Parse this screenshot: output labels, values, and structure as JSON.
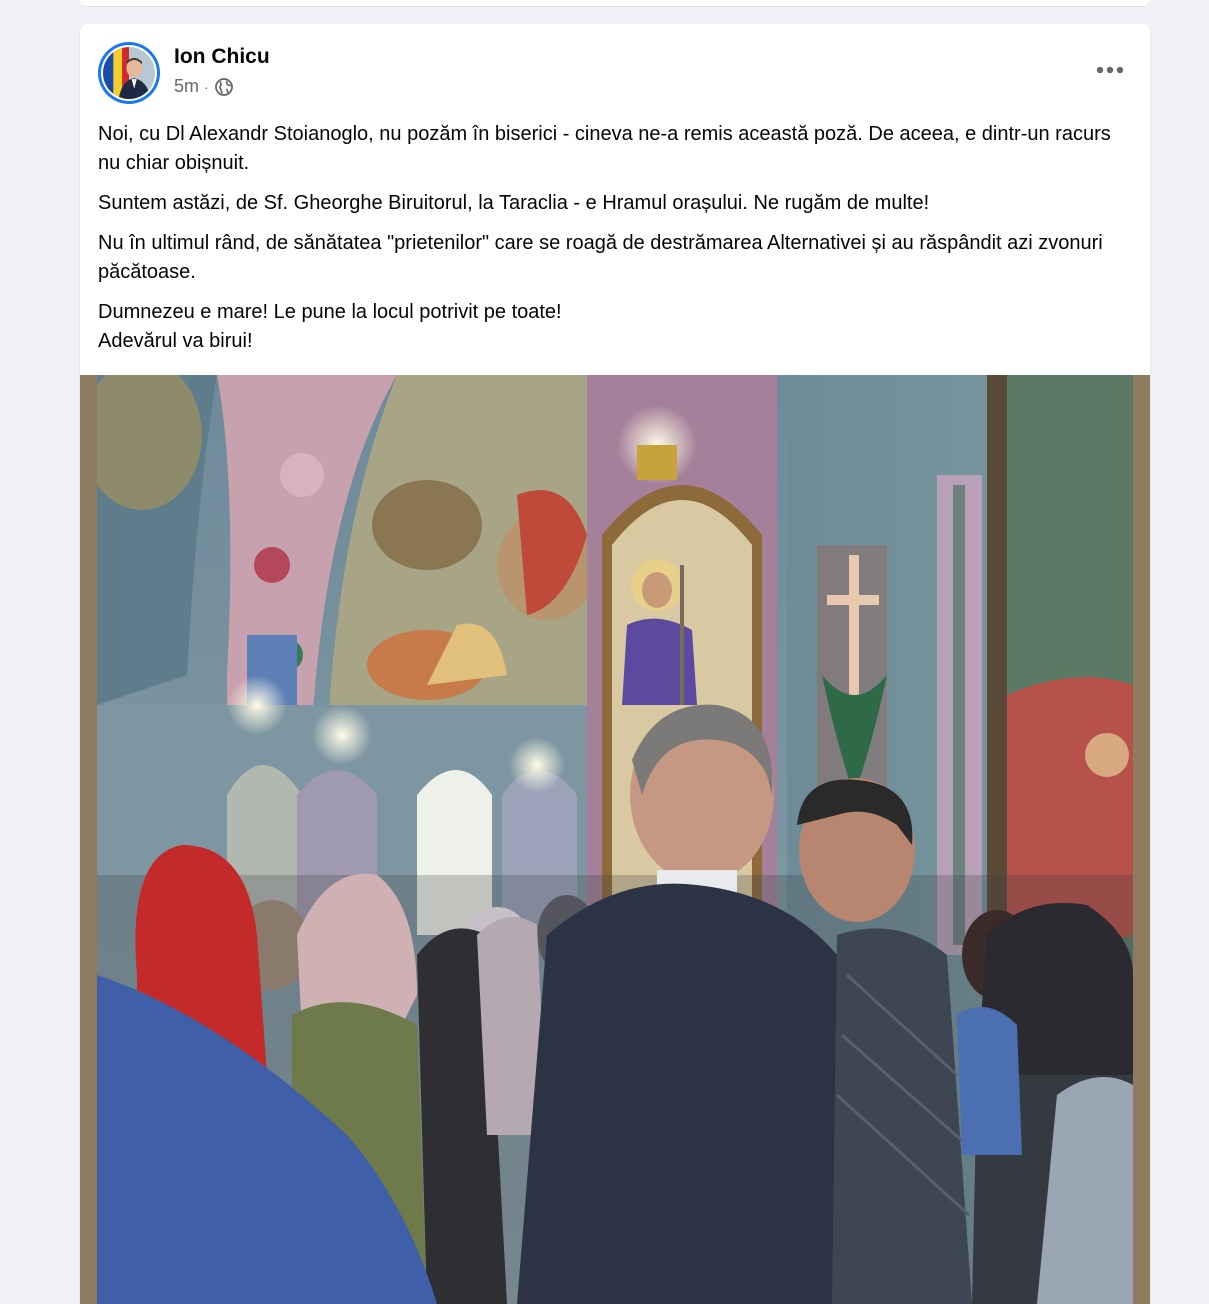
{
  "post": {
    "author": "Ion Chicu",
    "time": "5m",
    "separator": "·",
    "audience_icon": "globe-icon",
    "more_icon": "more-dots-icon",
    "paragraphs": [
      "Noi,  cu Dl Alexandr Stoianoglo, nu pozăm în biserici - cineva ne-a remis această poză. De aceea, e dintr-un racurs nu chiar obișnuit.",
      "Suntem astăzi, de Sf. Gheorghe Biruitorul, la Taraclia - e Hramul orașului. Ne rugăm de multe!",
      "Nu în ultimul rând, de sănătatea \"prietenilor\" care se roagă de destrămarea Alternativei și au răspândit azi zvonuri păcătoase.",
      "Dumnezeu e mare! Le pune la locul potrivit pe toate!\nAdevărul va birui!"
    ],
    "photo": {
      "description_icon": "church-interior-photo"
    }
  },
  "colors": {
    "accent": "#1877f2",
    "text_primary": "#050505",
    "text_secondary": "#65676b",
    "photo_border": "#8d7c60"
  }
}
